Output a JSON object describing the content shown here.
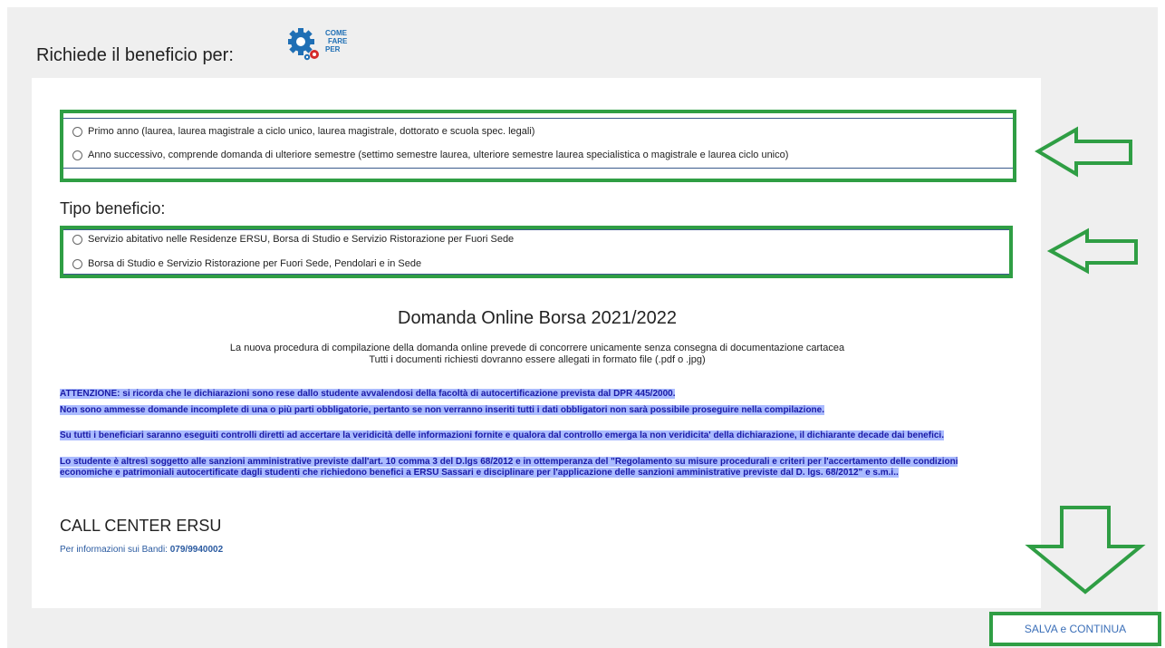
{
  "header": {
    "title": "Richiede il beneficio per:",
    "help_icon_text": [
      "COME",
      "FARE",
      "PER"
    ]
  },
  "beneficio_per": {
    "options": [
      "Primo anno (laurea, laurea magistrale a ciclo unico, laurea magistrale, dottorato e scuola spec. legali)",
      "Anno successivo, comprende domanda di ulteriore semestre (settimo semestre laurea, ulteriore semestre laurea specialistica o magistrale e laurea ciclo unico)"
    ]
  },
  "tipo_beneficio": {
    "title": "Tipo beneficio:",
    "options": [
      "Servizio abitativo nelle Residenze ERSU, Borsa di Studio e Servizio Ristorazione per Fuori Sede",
      "Borsa di Studio e Servizio Ristorazione per Fuori Sede, Pendolari e in Sede"
    ]
  },
  "domanda": {
    "title": "Domanda Online Borsa 2021/2022",
    "intro_1": "La nuova procedura di compilazione della domanda online prevede di concorrere unicamente senza consegna di documentazione cartacea",
    "intro_2": "Tutti i documenti richiesti dovranno essere allegati in formato file (.pdf o .jpg)"
  },
  "notices": [
    "ATTENZIONE: si ricorda che le dichiarazioni sono rese dallo studente avvalendosi della facoltà di autocertificazione prevista dal DPR 445/2000.",
    "Non sono ammesse domande incomplete di una o più parti obbligatorie, pertanto se non verranno inseriti tutti i dati obbligatori non sarà possibile proseguire nella compilazione.",
    "Su tutti i beneficiari saranno eseguiti controlli diretti ad accertare la veridicità delle informazioni fornite e qualora dal controllo emerga la non veridicita' della dichiarazione, il dichiarante decade dai benefici.",
    "Lo studente è altresì soggetto alle sanzioni amministrative previste dall'art. 10 comma 3 del D.lgs 68/2012 e in ottemperanza del \"Regolamento su misure procedurali e criteri per l'accertamento delle condizioni economiche e patrimoniali autocertificate dagli studenti che richiedono benefici a ERSU Sassari e disciplinare per l'applicazione delle sanzioni amministrative previste dal D. lgs. 68/2012\" e s.m.i.."
  ],
  "call_center": {
    "title": "CALL CENTER ERSU",
    "label": "Per informazioni sui Bandi:",
    "phone": "079/9940002"
  },
  "save_button": "SALVA e CONTINUA",
  "colors": {
    "highlight_green": "#2f9e44",
    "notice_text": "#1a1aa6",
    "notice_highlight": "#aabbff",
    "link_blue": "#3b6fb8",
    "gear_blue": "#1f6fb5",
    "gear_red": "#d42a2a"
  }
}
